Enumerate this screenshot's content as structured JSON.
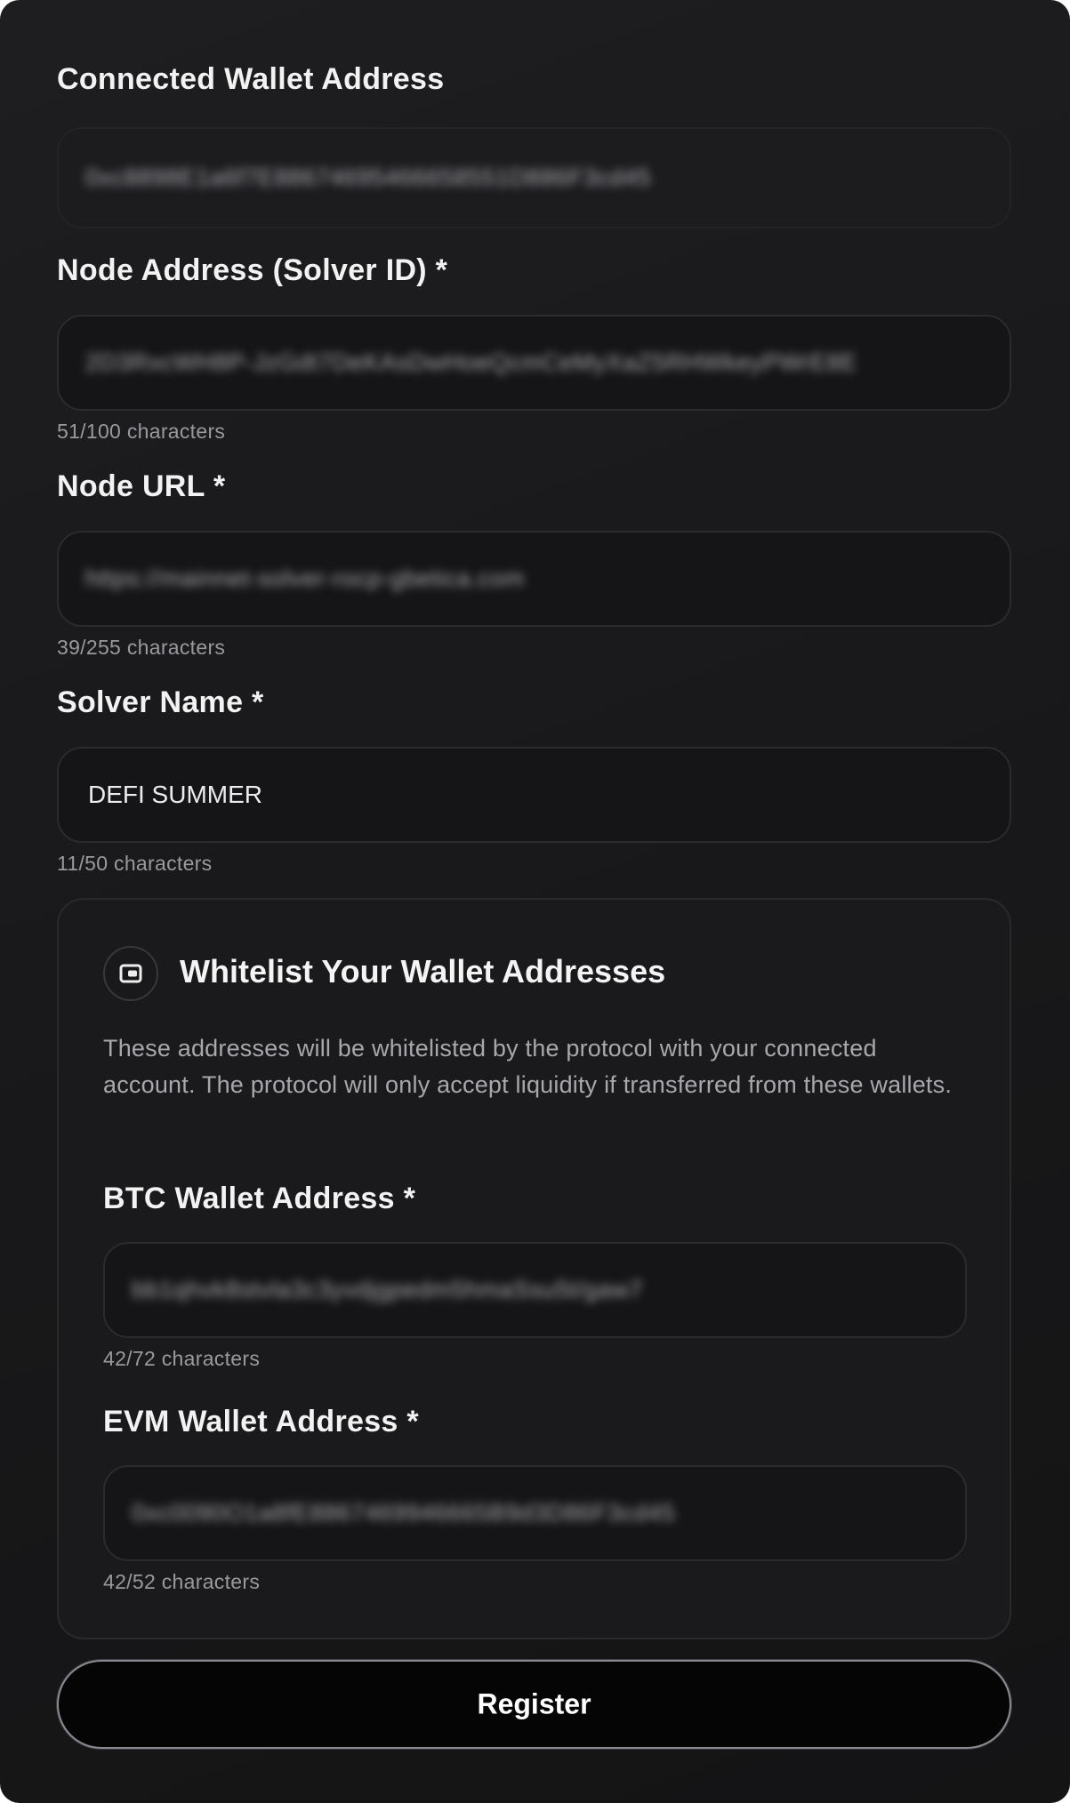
{
  "connected_wallet": {
    "label": "Connected Wallet Address",
    "value": "0xc8898E1a6f7E88674695466658551D886F3cd45"
  },
  "node_address": {
    "label": "Node Address (Solver ID) *",
    "value": "2D3RxcWH8P-JzGdt7DeKAsDwHoeQcmCeMyXaZ5RHWkeyPWrE8E",
    "counter": "51/100 characters"
  },
  "node_url": {
    "label": "Node URL *",
    "value": "https://mainnet-solver-rocp-gbetica.com",
    "counter": "39/255 characters"
  },
  "solver_name": {
    "label": "Solver Name *",
    "value": "DEFI SUMMER",
    "counter": "11/50 characters"
  },
  "whitelist": {
    "title": "Whitelist Your Wallet Addresses",
    "icon": "wallet-icon",
    "description": "These addresses will be whitelisted by the protocol with your connected account. The protocol will only accept liquidity if transferred from these wallets.",
    "btc": {
      "label": "BTC Wallet Address *",
      "value": "bb1qhvk8stvla3c3yvdjgpedm5hmaSsu5t/gaw7",
      "counter": "42/72 characters"
    },
    "evm": {
      "label": "EVM Wallet Address *",
      "value": "0xc0090O1a8fE8867469946665B9d3D86F3cd45",
      "counter": "42/52 characters"
    }
  },
  "register_label": "Register",
  "colors": {
    "background": "#1a1a1c",
    "field_border": "#2b2b2e",
    "text_primary": "#f2f2f2",
    "text_muted": "#9a9a9e"
  }
}
